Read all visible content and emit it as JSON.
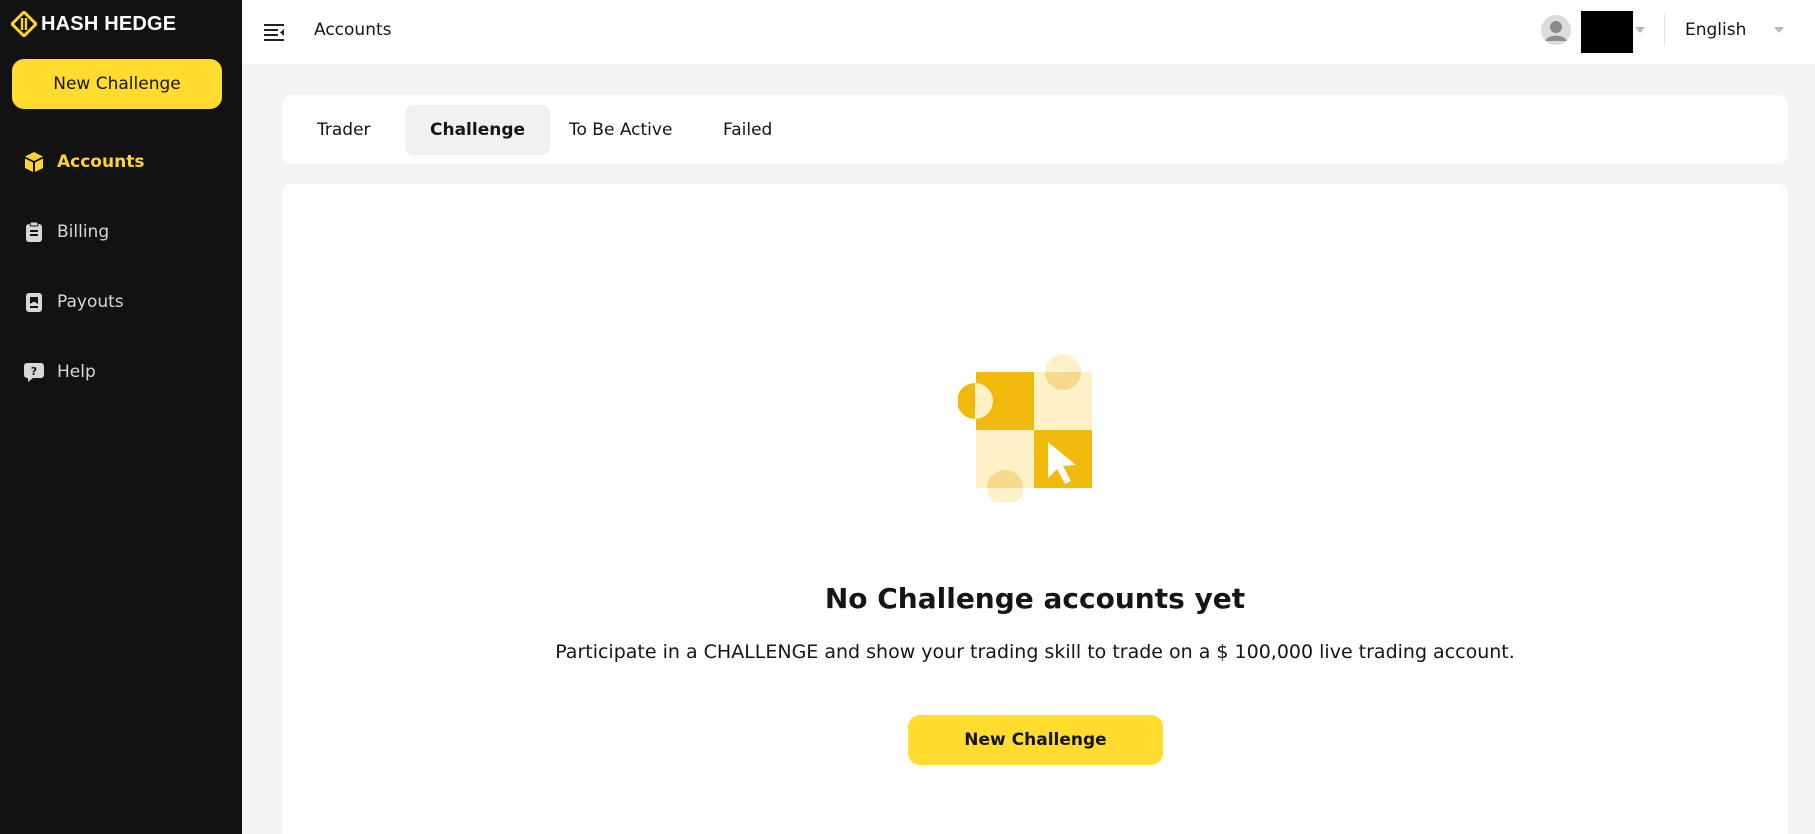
{
  "brand": {
    "name": "HASH HEDGE"
  },
  "sidebar": {
    "new_challenge_label": "New Challenge",
    "items": [
      {
        "label": "Accounts",
        "icon": "cube-icon",
        "active": true
      },
      {
        "label": "Billing",
        "icon": "clipboard-icon",
        "active": false
      },
      {
        "label": "Payouts",
        "icon": "wallet-icon",
        "active": false
      },
      {
        "label": "Help",
        "icon": "help-bubble-icon",
        "active": false
      }
    ]
  },
  "header": {
    "title": "Accounts",
    "language": "English"
  },
  "tabs": [
    {
      "label": "Trader",
      "active": false
    },
    {
      "label": "Challenge",
      "active": true
    },
    {
      "label": "To Be Active",
      "active": false
    },
    {
      "label": "Failed",
      "active": false
    }
  ],
  "empty_state": {
    "title": "No Challenge accounts yet",
    "description": "Participate in a CHALLENGE and show your trading skill to trade on a $ 100,000 live trading account.",
    "button_label": "New Challenge"
  },
  "colors": {
    "accent": "#ffdc2e",
    "sidebar_bg": "#121212",
    "illustration_dark": "#f0b90b",
    "illustration_light": "#fef0c7"
  }
}
